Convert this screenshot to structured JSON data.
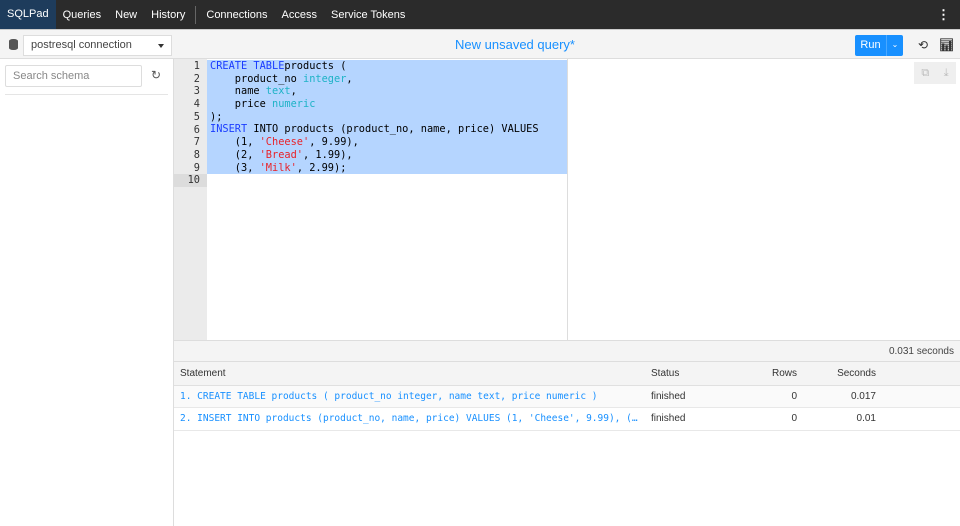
{
  "nav": {
    "brand": "SQLPad",
    "items": [
      "Queries",
      "New",
      "History"
    ],
    "admin_items": [
      "Connections",
      "Access",
      "Service Tokens"
    ],
    "more_icon": "kebab-icon"
  },
  "toolbar": {
    "connection": "postresql connection",
    "query_title": "New unsaved query*",
    "run_label": "Run"
  },
  "sidebar": {
    "search_placeholder": "Search schema"
  },
  "editor": {
    "line_numbers": [
      "1",
      "2",
      "3",
      "4",
      "5",
      "6",
      "7",
      "8",
      "9",
      "10"
    ],
    "lines": [
      [
        [
          "kw",
          "CREATE TABLE"
        ],
        [
          "",
          "products ("
        ]
      ],
      [
        [
          "",
          "    product_no "
        ],
        [
          "ty",
          "integer"
        ],
        [
          "",
          ","
        ]
      ],
      [
        [
          "",
          "    name "
        ],
        [
          "ty",
          "text"
        ],
        [
          "",
          ","
        ]
      ],
      [
        [
          "",
          "    price "
        ],
        [
          "ty",
          "numeric"
        ]
      ],
      [
        [
          "",
          ");"
        ]
      ],
      [
        [
          "kw",
          "INSERT"
        ],
        [
          "",
          "",
          " INTO products (product_no, name, price) VALUES"
        ]
      ],
      [
        [
          "",
          "    (1, "
        ],
        [
          "st",
          "'Cheese'"
        ],
        [
          "",
          ", 9.99),"
        ]
      ],
      [
        [
          "",
          "    (2, "
        ],
        [
          "st",
          "'Bread'"
        ],
        [
          "",
          ", 1.99),"
        ]
      ],
      [
        [
          "",
          "    (3, "
        ],
        [
          "st",
          "'Milk'"
        ],
        [
          "",
          ", 2.99);"
        ]
      ],
      [
        [
          "",
          ""
        ]
      ]
    ]
  },
  "results": {
    "elapsed": "0.031 seconds",
    "columns": [
      "Statement",
      "Status",
      "Rows",
      "Seconds"
    ],
    "rows": [
      {
        "statement": "1. CREATE TABLE products ( product_no integer, name text, price numeric )",
        "status": "finished",
        "rows": "0",
        "seconds": "0.017"
      },
      {
        "statement": "2. INSERT INTO products (product_no, name, price) VALUES (1, 'Cheese', 9.99), (2…",
        "status": "finished",
        "rows": "0",
        "seconds": "0.01"
      }
    ]
  }
}
